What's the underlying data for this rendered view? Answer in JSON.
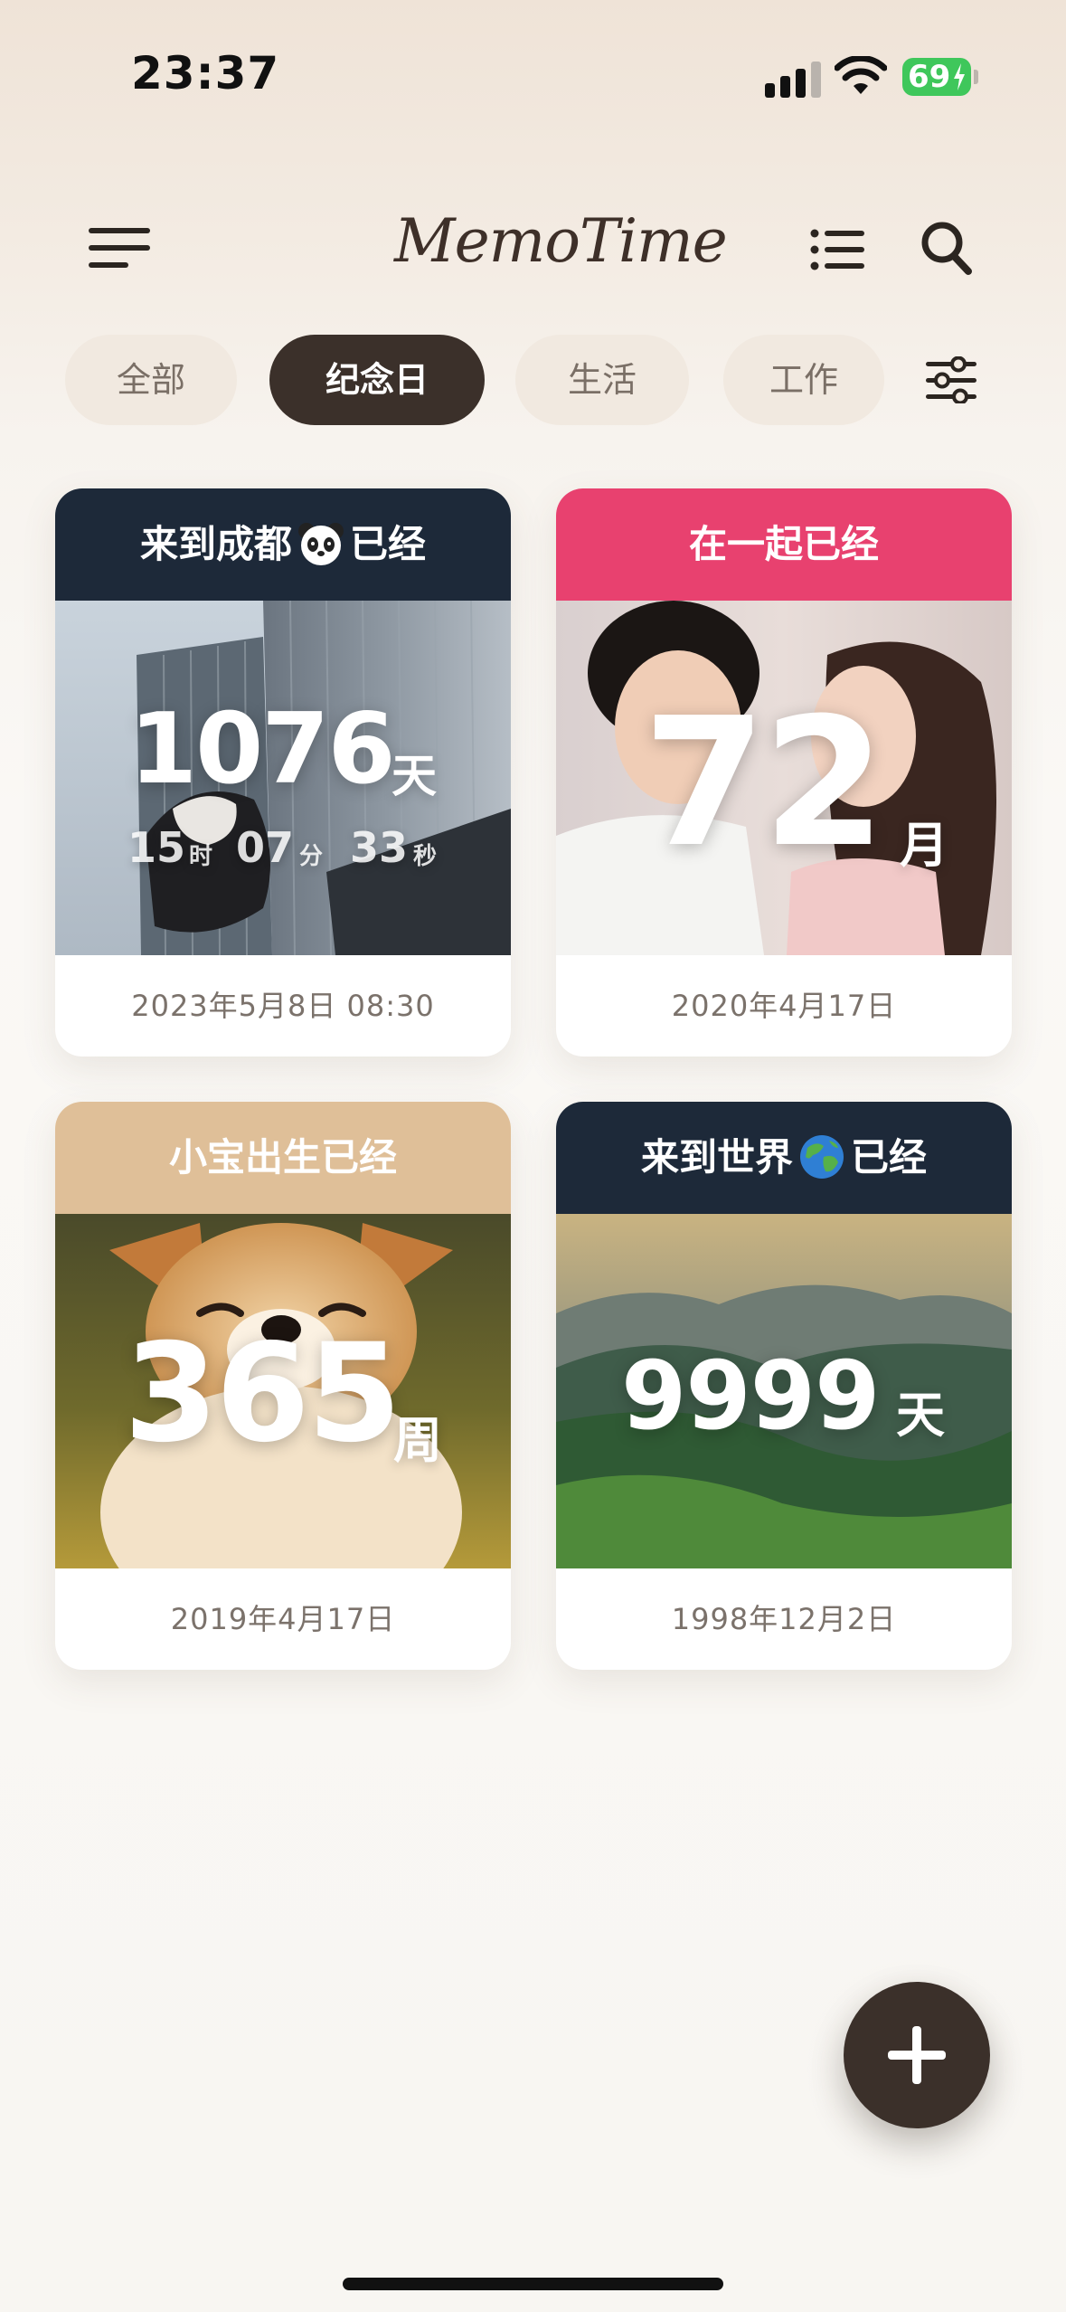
{
  "status_bar": {
    "time": "23:37",
    "battery": "69"
  },
  "header": {
    "app_name": "MemoTime"
  },
  "tabs": [
    {
      "label": "全部",
      "active": false
    },
    {
      "label": "纪念日",
      "active": true
    },
    {
      "label": "生活",
      "active": false
    },
    {
      "label": "工作",
      "active": false
    }
  ],
  "cards": [
    {
      "title_pre": "来到成都",
      "title_emoji": "panda-emoji",
      "title_post": "已经",
      "header_color": "#1d2939",
      "value": "1076",
      "unit": "天",
      "hours": "15",
      "hours_unit": "时",
      "minutes": "07",
      "minutes_unit": "分",
      "seconds": "33",
      "seconds_unit": "秒",
      "date": "2023年5月8日 08:30"
    },
    {
      "title": "在一起已经",
      "header_color": "#e8416f",
      "value": "72",
      "unit": "月",
      "date": "2020年4月17日"
    },
    {
      "title": "小宝出生已经",
      "header_color": "#dfbf98",
      "value": "365",
      "unit": "周",
      "date": "2019年4月17日"
    },
    {
      "title_pre": "来到世界",
      "title_emoji": "earth-emoji",
      "title_post": "已经",
      "header_color": "#1d2939",
      "value": "9999",
      "unit": "天",
      "date": "1998年12月2日"
    }
  ],
  "fab": {
    "icon": "plus-icon"
  }
}
